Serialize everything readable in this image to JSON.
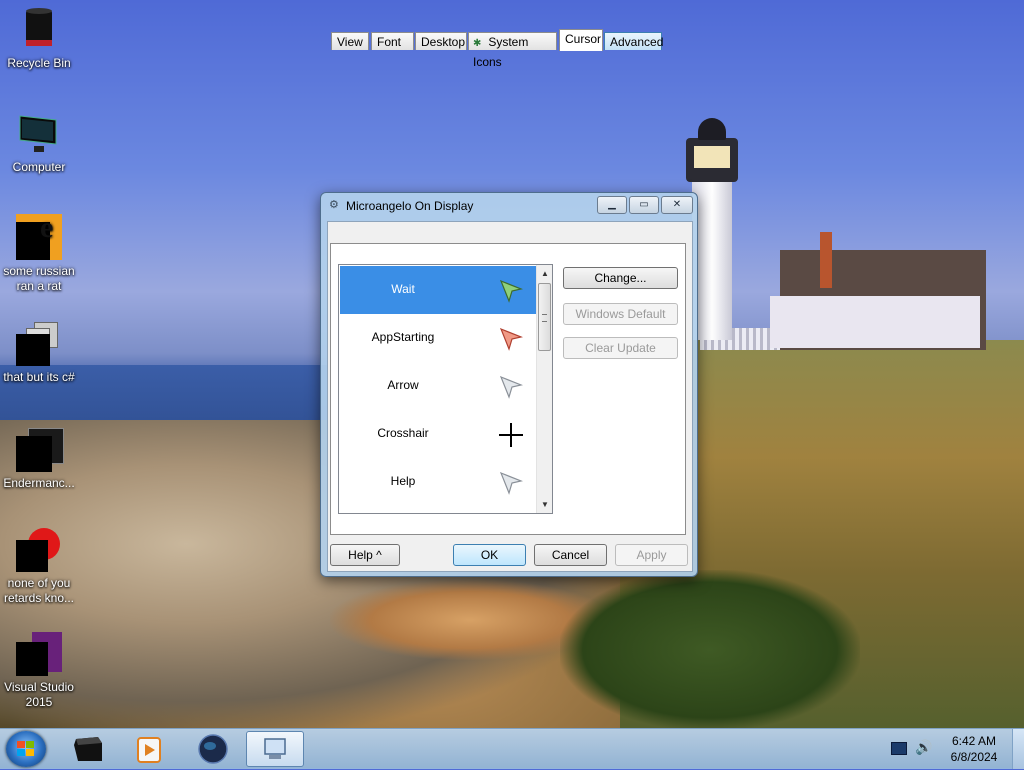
{
  "desktop": {
    "icons": [
      {
        "label": "Recycle Bin",
        "icon": "recycle-bin-icon"
      },
      {
        "label": "Computer",
        "icon": "computer-icon"
      },
      {
        "label": "some russian\nran a rat",
        "icon": "shortcut-icon"
      },
      {
        "label": "that but its c#",
        "icon": "shortcut-icon"
      },
      {
        "label": "Endermanc...",
        "icon": "shortcut-icon"
      },
      {
        "label": "none of you\nretards kno...",
        "icon": "shortcut-icon"
      },
      {
        "label": "Visual Studio\n2015",
        "icon": "visual-studio-icon"
      }
    ]
  },
  "dialog": {
    "title": "Microangelo On Display",
    "tabs": [
      {
        "label": "View"
      },
      {
        "label": "Font"
      },
      {
        "label": "Desktop"
      },
      {
        "label": "System Icons"
      },
      {
        "label": "Cursor"
      },
      {
        "label": "Advanced"
      }
    ],
    "active_tab": "Cursor",
    "cursor_list": [
      {
        "label": "Wait",
        "selected": true,
        "icon": "green-arrow-cursor-icon"
      },
      {
        "label": "AppStarting",
        "selected": false,
        "icon": "red-arrow-cursor-icon"
      },
      {
        "label": "Arrow",
        "selected": false,
        "icon": "arrow-cursor-icon"
      },
      {
        "label": "Crosshair",
        "selected": false,
        "icon": "crosshair-cursor-icon"
      },
      {
        "label": "Help",
        "selected": false,
        "icon": "help-cursor-icon"
      }
    ],
    "side_buttons": {
      "change": "Change...",
      "windows_default": "Windows Default",
      "clear_update": "Clear Update"
    },
    "bottom_buttons": {
      "help": "Help ^",
      "ok": "OK",
      "cancel": "Cancel",
      "apply": "Apply"
    }
  },
  "taskbar": {
    "clock_time": "6:42 AM",
    "clock_date": "6/8/2024"
  },
  "colors": {
    "selection": "#3a8ee6",
    "taskbar": "#a9c4e0"
  }
}
